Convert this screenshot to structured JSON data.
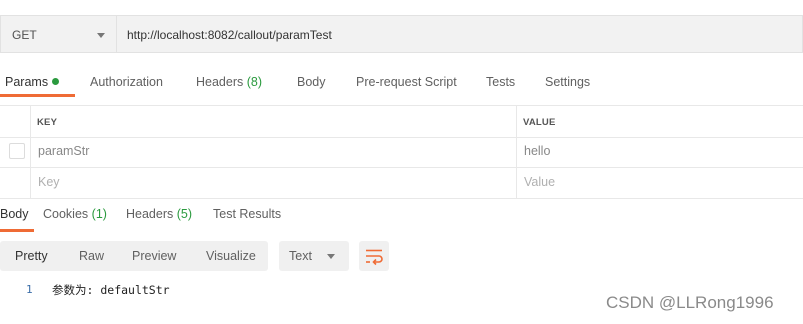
{
  "request": {
    "method": "GET",
    "url": "http://localhost:8082/callout/paramTest"
  },
  "request_tabs": [
    {
      "label": "Params",
      "count": "",
      "active": true
    },
    {
      "label": "Authorization",
      "count": ""
    },
    {
      "label": "Headers",
      "count": "(8)"
    },
    {
      "label": "Body",
      "count": ""
    },
    {
      "label": "Pre-request Script",
      "count": ""
    },
    {
      "label": "Tests",
      "count": ""
    },
    {
      "label": "Settings",
      "count": ""
    }
  ],
  "params": {
    "key_header": "KEY",
    "value_header": "VALUE",
    "rows": [
      {
        "key": "paramStr",
        "value": "hello"
      }
    ],
    "key_placeholder": "Key",
    "value_placeholder": "Value"
  },
  "response_tabs": [
    {
      "label": "Body",
      "count": "",
      "active": true
    },
    {
      "label": "Cookies",
      "count": "(1)"
    },
    {
      "label": "Headers",
      "count": "(5)"
    },
    {
      "label": "Test Results",
      "count": ""
    }
  ],
  "view_modes": [
    "Pretty",
    "Raw",
    "Preview",
    "Visualize"
  ],
  "format": "Text",
  "body_lines": [
    {
      "n": "1",
      "text": "参数为: defaultStr"
    }
  ],
  "watermark": "CSDN @LLRong1996",
  "colors": {
    "accent": "#ef6b35",
    "count_green": "#2a9a3e"
  },
  "icons": {
    "wrap": "wrap-lines-icon",
    "caret": "chevron-down-icon"
  }
}
